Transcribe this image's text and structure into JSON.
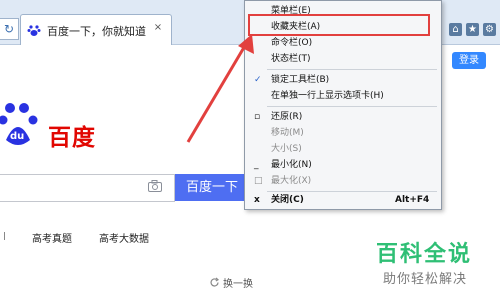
{
  "tab": {
    "title": "百度一下，你就知道",
    "close": "×"
  },
  "page": {
    "login": "登录",
    "logo_text": "百度",
    "logo_du": "du",
    "search_button": "百度一下",
    "links": [
      "高考真题",
      "高考大数据"
    ],
    "refresh": "换一换"
  },
  "menu": {
    "items": [
      {
        "label": "菜单栏(E)",
        "mark": "",
        "disabled": false
      },
      {
        "label": "收藏夹栏(A)",
        "mark": "",
        "disabled": false
      },
      {
        "label": "命令栏(O)",
        "mark": "",
        "disabled": false
      },
      {
        "label": "状态栏(T)",
        "mark": "",
        "disabled": false
      },
      {
        "label": "锁定工具栏(B)",
        "mark": "✓",
        "disabled": false
      },
      {
        "label": "在单独一行上显示选项卡(H)",
        "mark": "",
        "disabled": false
      },
      {
        "label": "还原(R)",
        "mark": "▫",
        "disabled": false
      },
      {
        "label": "移动(M)",
        "mark": "",
        "disabled": true
      },
      {
        "label": "大小(S)",
        "mark": "",
        "disabled": true
      },
      {
        "label": "最小化(N)",
        "mark": "_",
        "disabled": false
      },
      {
        "label": "最大化(X)",
        "mark": "□",
        "disabled": true
      },
      {
        "label": "关闭(C)",
        "mark": "x",
        "disabled": false,
        "shortcut": "Alt+F4"
      }
    ]
  },
  "watermark": {
    "title": "百科全说",
    "subtitle": "助你轻松解决"
  },
  "colors": {
    "highlight": "#e2403e",
    "arrow": "#e2403e",
    "baidu_red": "#e10601",
    "baidu_blue": "#2932e1",
    "search_btn": "#4e6ef2",
    "watermark": "#2fbf75"
  },
  "icons": [
    "home-icon",
    "star-icon",
    "gear-icon",
    "camera-icon",
    "refresh-icon"
  ]
}
